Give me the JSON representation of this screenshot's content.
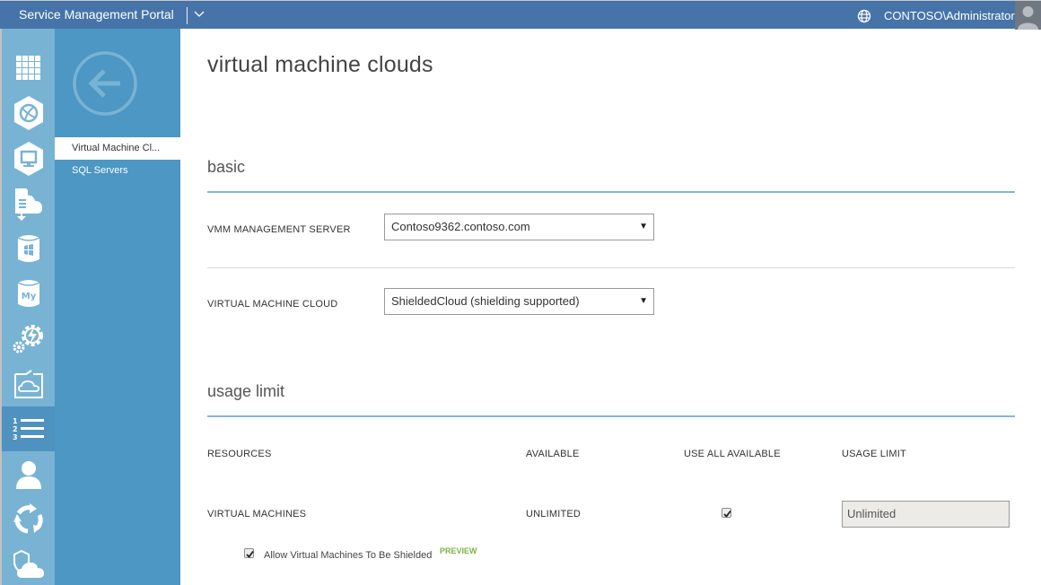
{
  "topbar": {
    "title": "Service Management Portal",
    "chevron_icon": "chevron-down-icon",
    "globe_icon": "globe-icon",
    "user": "CONTOSO\\Administrator",
    "avatar_icon": "user-avatar-icon"
  },
  "rail": {
    "items": [
      {
        "name": "all-items",
        "icon": "grid-icon"
      },
      {
        "name": "web-sites",
        "icon": "globe-hexagon-icon"
      },
      {
        "name": "virtual-machines",
        "icon": "monitor-hexagon-icon"
      },
      {
        "name": "service-bus",
        "icon": "cloud-download-icon"
      },
      {
        "name": "sql-servers",
        "icon": "sql-database-icon"
      },
      {
        "name": "mysql-servers",
        "icon": "mysql-database-icon"
      },
      {
        "name": "automation",
        "icon": "gears-lightning-icon"
      },
      {
        "name": "vm-clouds",
        "icon": "cloud-folder-icon"
      },
      {
        "name": "plans",
        "icon": "numbered-list-icon",
        "active": true
      },
      {
        "name": "user-accounts",
        "icon": "user-icon"
      },
      {
        "name": "usage",
        "icon": "refresh-cycle-icon"
      },
      {
        "name": "tenant-clouds",
        "icon": "shield-cloud-icon"
      }
    ]
  },
  "subnav": {
    "back_icon": "back-arrow-icon",
    "items": [
      {
        "label": "Virtual Machine Cl...",
        "active": true
      },
      {
        "label": "SQL Servers",
        "active": false
      }
    ]
  },
  "main": {
    "page_title": "virtual machine clouds",
    "basic": {
      "title": "basic",
      "vmm_server_label": "VMM MANAGEMENT SERVER",
      "vmm_server_value": "Contoso9362.contoso.com",
      "vm_cloud_label": "VIRTUAL MACHINE CLOUD",
      "vm_cloud_value": "ShieldedCloud (shielding supported)"
    },
    "usage_limit": {
      "title": "usage limit",
      "columns": [
        "RESOURCES",
        "AVAILABLE",
        "USE ALL AVAILABLE",
        "USAGE LIMIT"
      ],
      "rows": [
        {
          "resource": "VIRTUAL MACHINES",
          "available": "UNLIMITED",
          "use_all_available": true,
          "usage_limit": "Unlimited"
        }
      ],
      "allow_shielded_label": "Allow Virtual Machines To Be Shielded",
      "allow_shielded_checked": true,
      "preview_badge": "PREVIEW"
    }
  },
  "colors": {
    "topbar": "#4674a8",
    "rail": "#78b3d4",
    "subnav": "#4c97c3",
    "section_rule": "#86b5de",
    "preview": "#7cb342"
  }
}
